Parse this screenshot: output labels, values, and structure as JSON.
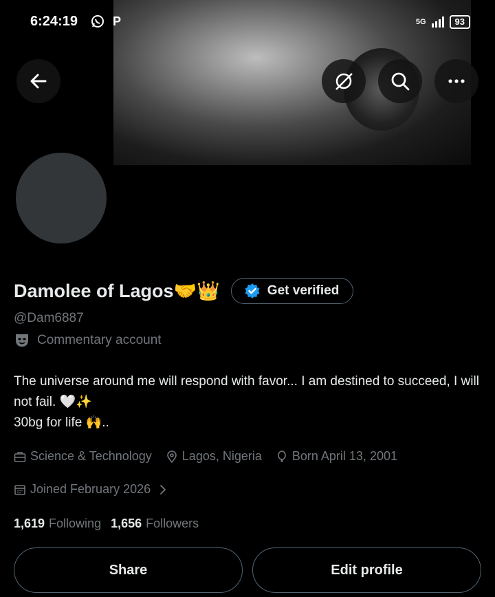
{
  "status_bar": {
    "time": "6:24:19",
    "network": "5G",
    "battery": "93"
  },
  "profile": {
    "display_name": "Damolee of Lagos🤝👑",
    "verify_label": "Get verified",
    "handle": "@Dam6887",
    "category": "Commentary account",
    "bio_line1": "The universe around me will respond with favor... I am destined to succeed, I will not fail. 🤍✨",
    "bio_line2": "30bg for life 🙌..",
    "industry": "Science & Technology",
    "location": "Lagos, Nigeria",
    "born": "Born April 13, 2001",
    "joined": "Joined February 2026",
    "following_count": "1,619",
    "following_label": "Following",
    "followers_count": "1,656",
    "followers_label": "Followers"
  },
  "actions": {
    "share": "Share",
    "edit_profile": "Edit profile"
  },
  "colors": {
    "background": "#000000",
    "muted": "#71767b",
    "text": "#e7e9ea",
    "verified_blue": "#1d9bf0",
    "avatar_placeholder": "#333639"
  },
  "icons": [
    "whatsapp-icon",
    "p-icon",
    "signal-icon",
    "battery-icon",
    "back-arrow-icon",
    "grok-icon",
    "search-icon",
    "more-icon",
    "verified-badge-icon",
    "commentary-mask-icon",
    "briefcase-icon",
    "location-pin-icon",
    "balloon-icon",
    "calendar-icon",
    "chevron-right-icon"
  ]
}
